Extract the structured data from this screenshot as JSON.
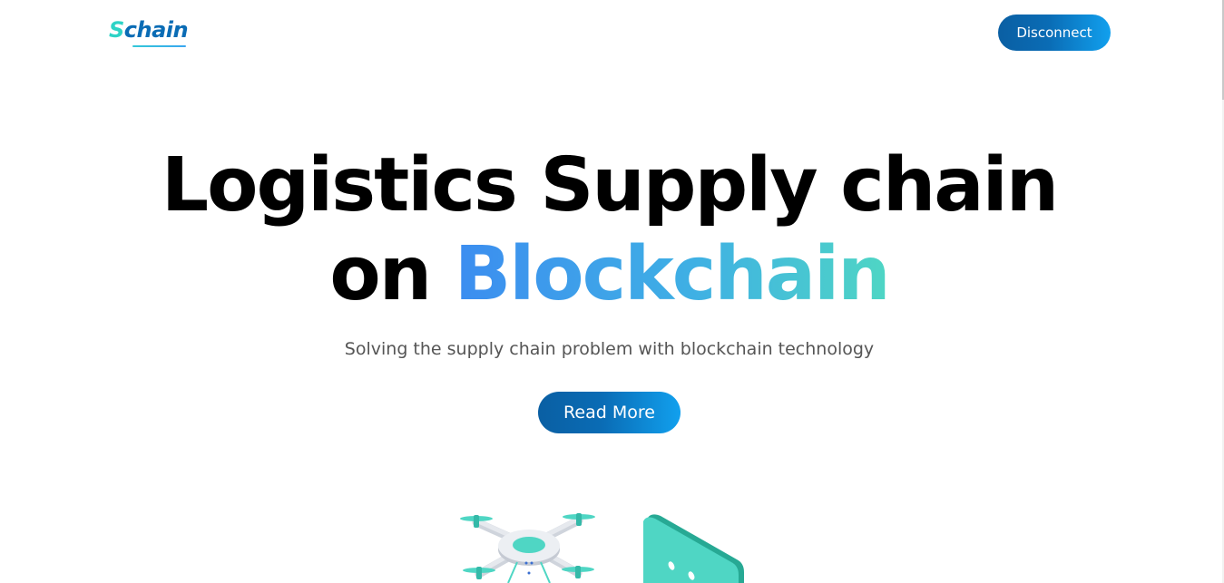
{
  "header": {
    "logo_first_letter": "S",
    "logo_rest": "chain",
    "disconnect_label": "Disconnect"
  },
  "hero": {
    "title_line1": "Logistics Supply chain",
    "title_line2_prefix": "on ",
    "title_line2_accent": "Blockchain",
    "subtitle": "Solving the supply chain problem with blockchain technology",
    "read_more_label": "Read More"
  },
  "colors": {
    "brand_dark": "#0a6cb5",
    "brand_light": "#11a0ee",
    "accent_teal": "#4fd6c4",
    "accent_blue": "#3c8df0"
  },
  "illustrations": [
    "drone-illustration",
    "phone-illustration"
  ]
}
